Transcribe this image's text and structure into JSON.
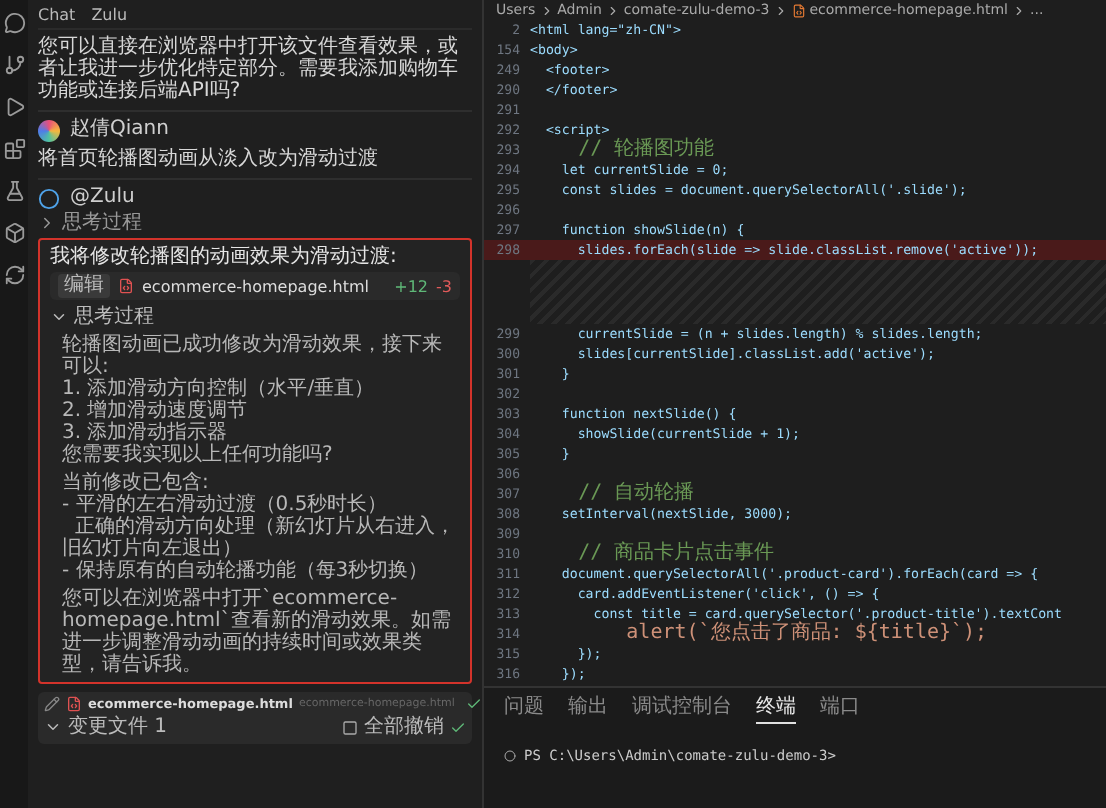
{
  "chat": {
    "title": "Chat",
    "subtitle": "Zulu",
    "assistant_reply": "您可以直接在浏览器中打开该文件查看效果，或者让我进一步优化特定部分。需要我添加购物车功能或连接后端API吗?",
    "user": {
      "name": "赵倩Qiann",
      "text": "将首页轮播图动画从淡入改为滑动过渡"
    },
    "agent": {
      "name": "@Zulu",
      "thinking": {
        "label": "思考过程",
        "expanded": false
      }
    },
    "card": {
      "title": "我将修改轮播图的动画效果为滑动过渡:",
      "file_chip": {
        "action": "编辑",
        "file": "ecommerce-homepage.html",
        "added": "+12",
        "removed": "-3"
      },
      "thinking": {
        "label": "思考过程",
        "expanded": true,
        "paragraphs": [
          [
            "轮播图动画已成功修改为滑动效果，接下来可以:",
            "1. 添加滑动方向控制（水平/垂直）",
            "2. 增加滑动速度调节",
            "3. 添加滑动指示器",
            "您需要我实现以上任何功能吗?"
          ],
          [
            "当前修改已包含:",
            "- 平滑的左右滑动过渡（0.5秒时长）",
            "  正确的滑动方向处理（新幻灯片从右进入，旧幻灯片向左退出）",
            "- 保持原有的自动轮播功能（每3秒切换）"
          ],
          [
            "您可以在浏览器中打开`ecommerce-homepage.html`查看新的滑动效果。如需进一步调整滑动动画的持续时间或效果类型，请告诉我。"
          ]
        ]
      }
    },
    "changes": {
      "file": "ecommerce-homepage.html",
      "path": "ecommerce-homepage.html",
      "summary": {
        "label": "变更文件 1",
        "expanded": true
      },
      "undo_all": "全部撤销"
    }
  },
  "editor": {
    "breadcrumb": [
      "Users",
      "Admin",
      "comate-zulu-demo-3",
      "ecommerce-homepage.html",
      "..."
    ],
    "lines": [
      {
        "num": "2",
        "kind": "code",
        "deleted": false,
        "text": "<html lang=\"zh-CN\">"
      },
      {
        "num": "154",
        "kind": "code",
        "deleted": false,
        "text": "<body>"
      },
      {
        "num": "249",
        "kind": "code",
        "deleted": false,
        "text": "  <footer>"
      },
      {
        "num": "290",
        "kind": "code",
        "deleted": false,
        "text": "  </footer>"
      },
      {
        "num": "291",
        "deleted": false
      },
      {
        "num": "292",
        "kind": "code",
        "deleted": false,
        "text": "  <script>"
      },
      {
        "num": "293",
        "kind": "comment",
        "deleted": false,
        "text": "    // 轮播图功能"
      },
      {
        "num": "294",
        "kind": "code",
        "deleted": false,
        "text": "    let currentSlide = 0;"
      },
      {
        "num": "295",
        "kind": "code",
        "deleted": false,
        "text": "    const slides = document.querySelectorAll('.slide');"
      },
      {
        "num": "296",
        "deleted": false
      },
      {
        "num": "297",
        "kind": "code",
        "deleted": false,
        "text": "    function showSlide(n) {"
      },
      {
        "num": "298",
        "kind": "code",
        "deleted": true,
        "text": "      slides.forEach(slide => slide.classList.remove('active'));"
      },
      {
        "num": "299",
        "kind": "code",
        "deleted": false,
        "text": "      currentSlide = (n + slides.length) % slides.length;"
      },
      {
        "num": "300",
        "kind": "code",
        "deleted": false,
        "text": "      slides[currentSlide].classList.add('active');"
      },
      {
        "num": "301",
        "kind": "code",
        "deleted": false,
        "text": "    }"
      },
      {
        "num": "302",
        "deleted": false
      },
      {
        "num": "303",
        "kind": "code",
        "deleted": false,
        "text": "    function nextSlide() {"
      },
      {
        "num": "304",
        "kind": "code",
        "deleted": false,
        "text": "      showSlide(currentSlide + 1);"
      },
      {
        "num": "305",
        "kind": "code",
        "deleted": false,
        "text": "    }"
      },
      {
        "num": "306",
        "deleted": false
      },
      {
        "num": "307",
        "kind": "comment",
        "deleted": false,
        "text": "    // 自动轮播"
      },
      {
        "num": "308",
        "kind": "code",
        "deleted": false,
        "text": "    setInterval(nextSlide, 3000);"
      },
      {
        "num": "309",
        "deleted": false
      },
      {
        "num": "310",
        "kind": "comment",
        "deleted": false,
        "text": "    // 商品卡片点击事件"
      },
      {
        "num": "311",
        "kind": "code",
        "deleted": false,
        "text": "    document.querySelectorAll('.product-card').forEach(card => {"
      },
      {
        "num": "312",
        "kind": "code",
        "deleted": false,
        "text": "      card.addEventListener('click', () => {"
      },
      {
        "num": "313",
        "kind": "code",
        "deleted": false,
        "text": "        const title = card.querySelector('.product-title').textCont"
      },
      {
        "num": "314",
        "kind": "text",
        "deleted": false,
        "text": "        alert(`您点击了商品: ${title}`);"
      },
      {
        "num": "315",
        "kind": "code",
        "deleted": false,
        "text": "      });"
      },
      {
        "num": "316",
        "kind": "code",
        "deleted": false,
        "text": "    });"
      }
    ]
  },
  "panel": {
    "tabs": [
      {
        "label": "问题",
        "selected": false
      },
      {
        "label": "输出",
        "selected": false
      },
      {
        "label": "调试控制台",
        "selected": false
      },
      {
        "label": "终端",
        "selected": true
      },
      {
        "label": "端口",
        "selected": false
      }
    ],
    "terminal": "PS C:\\Users\\Admin\\comate-zulu-demo-3>"
  }
}
